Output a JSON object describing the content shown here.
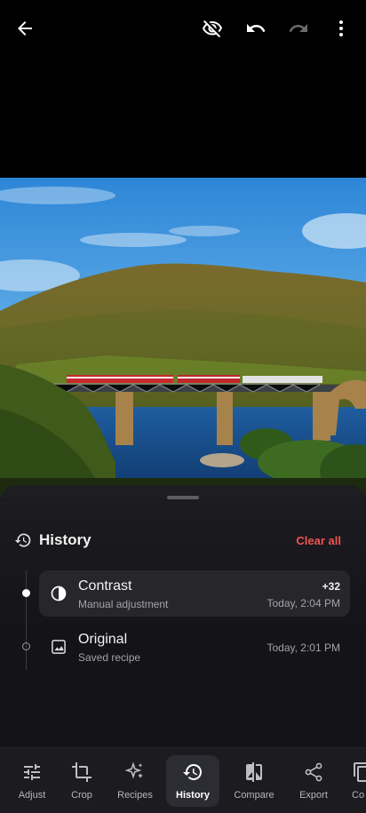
{
  "topbar": {
    "back_icon": "arrow-back-icon",
    "hide_icon": "visibility-off-icon",
    "undo_icon": "undo-icon",
    "redo_icon": "redo-icon",
    "more_icon": "more-vert-icon"
  },
  "photo": {
    "description_icon": "landscape-photo"
  },
  "history": {
    "title": "History",
    "clear_label": "Clear all",
    "items": [
      {
        "name": "Contrast",
        "subtitle": "Manual adjustment",
        "value": "+32",
        "time": "Today, 2:04 PM",
        "active": true,
        "icon": "contrast-icon"
      },
      {
        "name": "Original",
        "subtitle": "Saved recipe",
        "value": "",
        "time": "Today, 2:01 PM",
        "active": false,
        "icon": "image-icon"
      }
    ]
  },
  "nav": {
    "items": [
      {
        "label": "Adjust",
        "icon": "tune-icon"
      },
      {
        "label": "Crop",
        "icon": "crop-icon"
      },
      {
        "label": "Recipes",
        "icon": "sparkle-icon"
      },
      {
        "label": "History",
        "icon": "history-icon",
        "active": true
      },
      {
        "label": "Compare",
        "icon": "compare-icon"
      },
      {
        "label": "Export",
        "icon": "share-icon"
      },
      {
        "label": "Co",
        "icon": "copy-icon"
      }
    ]
  },
  "colors": {
    "accent_red": "#ef5350",
    "sheet_bg": "#1e1e22",
    "nav_bg": "#1b1b20"
  }
}
